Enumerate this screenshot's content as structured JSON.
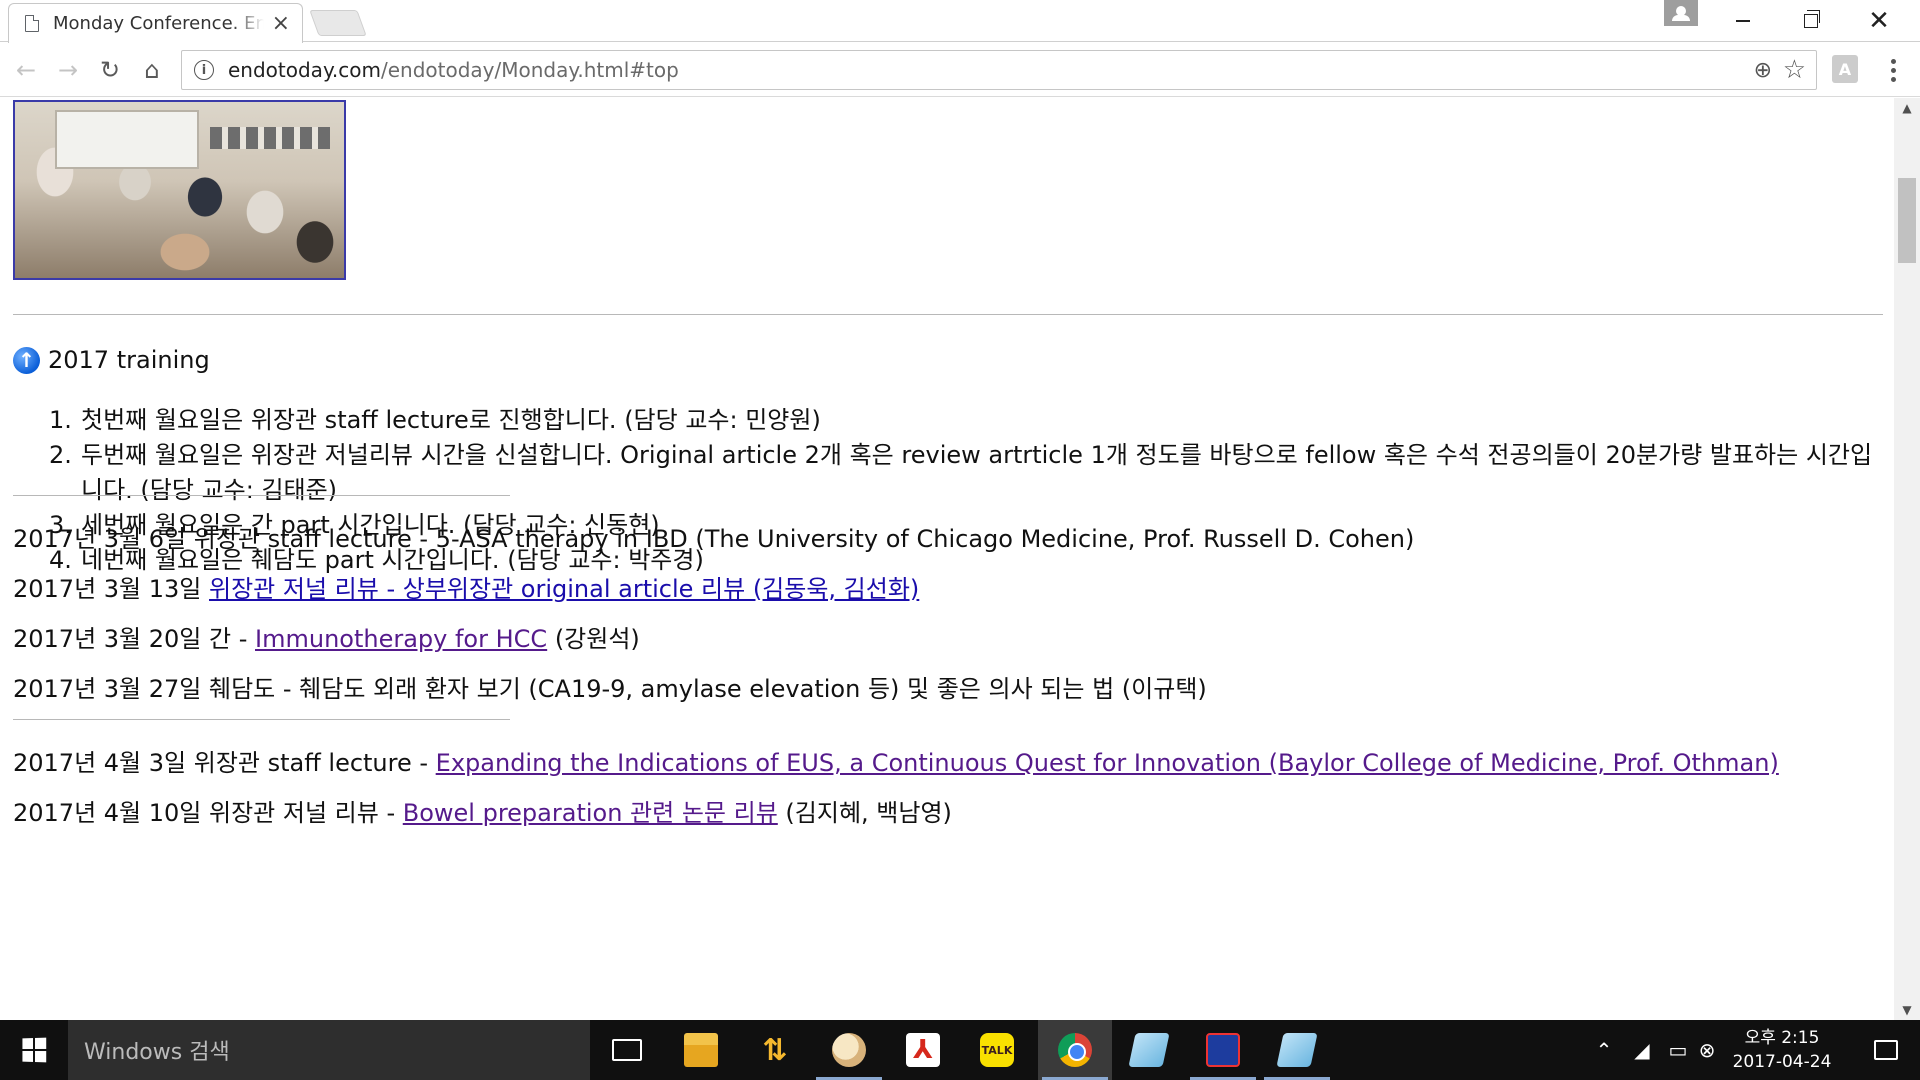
{
  "browser": {
    "tab_title": "Monday Conference. Endotoday",
    "tab_close": "×",
    "url_domain": "endotoday.com",
    "url_path": "/endotoday/Monday.html#top",
    "ext_label": "A"
  },
  "page": {
    "section_title": "2017 training",
    "training_items": [
      {
        "num": "1.",
        "text": "첫번째 월요일은 위장관 staff lecture로 진행합니다. (담당 교수: 민양원)"
      },
      {
        "num": "2.",
        "text": "두번째 월요일은 위장관 저널리뷰 시간을 신설합니다. Original article 2개 혹은 review artrticle 1개 정도를 바탕으로 fellow 혹은 수석 전공의들이 20분가량 발표하는 시간입니다. (담당 교수: 김태준)"
      },
      {
        "num": "3.",
        "text": "세번째 월요일은 간 part 시간입니다. (담당 교수: 신동현)"
      },
      {
        "num": "4.",
        "text": "네번째 월요일은 췌담도 part 시간입니다. (담당 교수: 박주경)"
      }
    ],
    "entries": [
      {
        "pre": "2017년 3월 6일 위장관 staff lecture - 5-ASA therapy in IBD (The University of Chicago Medicine, Prof. Russell D. Cohen)",
        "link": "",
        "post": ""
      },
      {
        "pre": "2017년 3월 13일 ",
        "link": "위장관 저널 리뷰 - 상부위장관 original article 리뷰 (김동욱, 김선화)",
        "post": ""
      },
      {
        "pre": "2017년 3월 20일 간 - ",
        "link": "Immunotherapy for HCC",
        "post": " (강원석)"
      },
      {
        "pre": "2017년 3월 27일 췌담도 - 췌담도 외래 환자 보기 (CA19-9, amylase elevation 등) 및 좋은 의사 되는 법 (이규택)",
        "link": "",
        "post": ""
      },
      {
        "pre": "2017년 4월 3일 위장관 staff lecture - ",
        "link": "Expanding the Indications of EUS, a Continuous Quest for Innovation (Baylor College of Medicine, Prof. Othman)",
        "post": ""
      },
      {
        "pre": "2017년 4월 10일 위장관 저널 리뷰 - ",
        "link": "Bowel preparation 관련 논문 리뷰",
        "post": " (김지혜, 백남영)"
      }
    ]
  },
  "taskbar": {
    "search_placeholder": "Windows 검색",
    "time": "오후 2:15",
    "date": "2017-04-24",
    "talk_label": "TALK"
  },
  "colors": {
    "link": "#1a0dab",
    "visited_link": "#551a8b",
    "taskbar_bg": "#101010"
  }
}
